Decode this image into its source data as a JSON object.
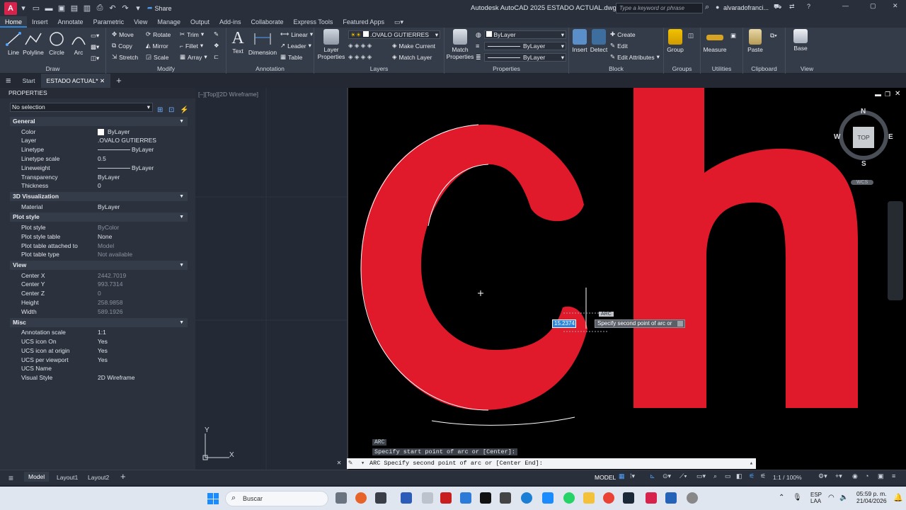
{
  "titlebar": {
    "app_letter": "A",
    "share_label": "Share",
    "title": "Autodesk AutoCAD 2025   ESTADO ACTUAL.dwg",
    "search_placeholder": "Type a keyword or phrase",
    "user": "alvaradofranci..."
  },
  "ribbon_tabs": [
    "Home",
    "Insert",
    "Annotate",
    "Parametric",
    "View",
    "Manage",
    "Output",
    "Add-ins",
    "Collaborate",
    "Express Tools",
    "Featured Apps"
  ],
  "ribbon": {
    "draw": {
      "label": "Draw",
      "line": "Line",
      "polyline": "Polyline",
      "circle": "Circle",
      "arc": "Arc"
    },
    "modify": {
      "label": "Modify",
      "move": "Move",
      "rotate": "Rotate",
      "trim": "Trim",
      "copy": "Copy",
      "mirror": "Mirror",
      "fillet": "Fillet",
      "stretch": "Stretch",
      "scale": "Scale",
      "array": "Array"
    },
    "annotation": {
      "label": "Annotation",
      "text": "Text",
      "dimension": "Dimension",
      "linear": "Linear",
      "leader": "Leader",
      "table": "Table"
    },
    "layers": {
      "label": "Layers",
      "layer_properties_1": "Layer",
      "layer_properties_2": "Properties",
      "current_layer": ".OVALO GUTIERRES",
      "make_current": "Make Current",
      "match_layer": "Match Layer"
    },
    "properties": {
      "label": "Properties",
      "match_1": "Match",
      "match_2": "Properties",
      "color": "ByLayer",
      "linetype": "ByLayer",
      "lineweight": "ByLayer"
    },
    "block": {
      "label": "Block",
      "insert": "Insert",
      "detect": "Detect",
      "create": "Create",
      "edit": "Edit",
      "edit_attributes": "Edit Attributes"
    },
    "groups": {
      "label": "Groups",
      "group": "Group"
    },
    "utilities": {
      "label": "Utilities",
      "measure": "Measure"
    },
    "clipboard": {
      "label": "Clipboard",
      "paste": "Paste"
    },
    "view": {
      "label": "View",
      "base": "Base"
    }
  },
  "doc_tabs": {
    "start": "Start",
    "active": "ESTADO ACTUAL*"
  },
  "properties_panel": {
    "title": "PROPERTIES",
    "selection": "No selection",
    "sections": [
      {
        "name": "General",
        "rows": [
          {
            "k": "Color",
            "v": "ByLayer"
          },
          {
            "k": "Layer",
            "v": ".OVALO GUTIERRES"
          },
          {
            "k": "Linetype",
            "v": "ByLayer"
          },
          {
            "k": "Linetype scale",
            "v": "0.5"
          },
          {
            "k": "Lineweight",
            "v": "ByLayer"
          },
          {
            "k": "Transparency",
            "v": "ByLayer"
          },
          {
            "k": "Thickness",
            "v": "0"
          }
        ]
      },
      {
        "name": "3D Visualization",
        "rows": [
          {
            "k": "Material",
            "v": "ByLayer"
          }
        ]
      },
      {
        "name": "Plot style",
        "rows": [
          {
            "k": "Plot style",
            "v": "ByColor"
          },
          {
            "k": "Plot style table",
            "v": "None"
          },
          {
            "k": "Plot table attached to",
            "v": "Model"
          },
          {
            "k": "Plot table type",
            "v": "Not available"
          }
        ]
      },
      {
        "name": "View",
        "rows": [
          {
            "k": "Center X",
            "v": "2442.7019"
          },
          {
            "k": "Center Y",
            "v": "993.7314"
          },
          {
            "k": "Center Z",
            "v": "0"
          },
          {
            "k": "Height",
            "v": "258.9858"
          },
          {
            "k": "Width",
            "v": "589.1926"
          }
        ]
      },
      {
        "name": "Misc",
        "rows": [
          {
            "k": "Annotation scale",
            "v": "1:1"
          },
          {
            "k": "UCS icon On",
            "v": "Yes"
          },
          {
            "k": "UCS icon at origin",
            "v": "Yes"
          },
          {
            "k": "UCS per viewport",
            "v": "Yes"
          },
          {
            "k": "UCS Name",
            "v": ""
          },
          {
            "k": "Visual Style",
            "v": "2D Wireframe"
          }
        ]
      }
    ]
  },
  "viewport": {
    "label": "[–][Top][2D Wireframe]",
    "viewcube": {
      "n": "N",
      "s": "S",
      "e": "E",
      "w": "W",
      "face": "TOP",
      "ucs": "WCS"
    },
    "input_value": "15.2374",
    "tooltip": "Specify second point of arc or",
    "angle_label": "ARC",
    "history_line_1": "ARC",
    "history_line_2": "Specify start point of arc or [Center]:",
    "command_line": "ARC Specify second point of arc or [Center End]:",
    "ucs_x": "X",
    "ucs_y": "Y"
  },
  "status": {
    "model": "Model",
    "layout1": "Layout1",
    "layout2": "Layout2",
    "mode": "MODEL",
    "scale": "1:1 / 100%"
  },
  "taskbar": {
    "search": "Buscar",
    "lang_1": "ESP",
    "lang_2": "LAA",
    "time": "05:59 p. m.",
    "date": "21/04/2026"
  },
  "colors": {
    "accent": "#2f85d6",
    "cad_red": "#e01a2b",
    "app_red": "#d7224b"
  }
}
